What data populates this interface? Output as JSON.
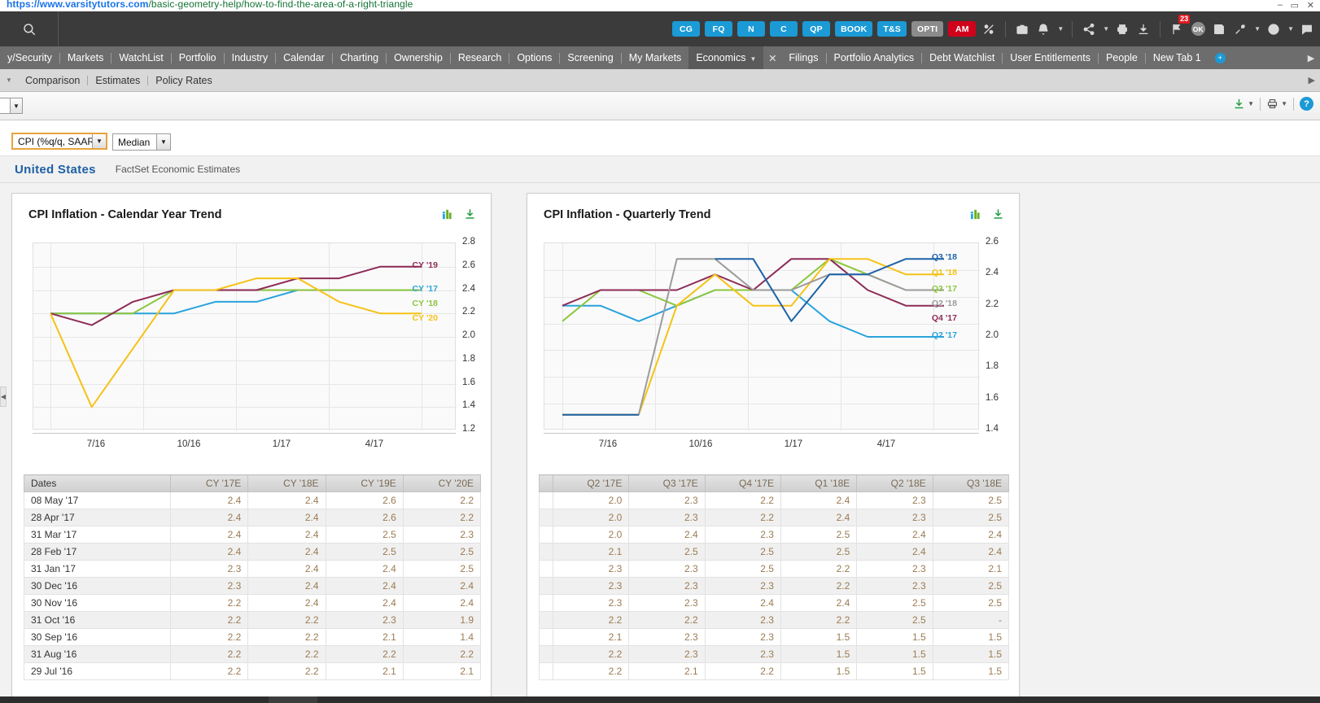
{
  "browser": {
    "url_protocol": "https://www.",
    "url_domain": "varsitytutors.com",
    "url_path": "/basic-geometry-help/how-to-find-the-area-of-a-right-triangle",
    "minimize": "–",
    "maximize": "▭",
    "close": "✕"
  },
  "header": {
    "search_icon": "search-icon",
    "quick_buttons": [
      {
        "label": "CG",
        "style": "blue"
      },
      {
        "label": "FQ",
        "style": "blue"
      },
      {
        "label": "N",
        "style": "blue"
      },
      {
        "label": "C",
        "style": "blue"
      },
      {
        "label": "QP",
        "style": "blue"
      },
      {
        "label": "BOOK",
        "style": "blue"
      },
      {
        "label": "T&S",
        "style": "blue"
      },
      {
        "label": "OPTI",
        "style": "gray"
      },
      {
        "label": "AM",
        "style": "red"
      }
    ],
    "notification_count": "23",
    "ok_label": "OK",
    "colors": {
      "blue": "#1b9ad6",
      "gray": "#8b8b8b",
      "red": "#d0021b"
    }
  },
  "nav": {
    "left_items": [
      "y/Security",
      "Markets",
      "WatchList",
      "Portfolio",
      "Industry",
      "Calendar",
      "Charting",
      "Ownership",
      "Research",
      "Options",
      "Screening",
      "My Markets"
    ],
    "active_tab": "Economics",
    "right_items": [
      "Filings",
      "Portfolio Analytics",
      "Debt Watchlist",
      "User Entitlements",
      "People",
      "New Tab 1"
    ],
    "add_tab": "+",
    "scroll_right": "▶"
  },
  "subnav": {
    "items": [
      "Comparison",
      "Estimates",
      "Policy Rates"
    ],
    "scroll_right": "▶"
  },
  "filters": {
    "metric": "CPI (%q/q, SAAR)",
    "statistic": "Median",
    "calendar_icon": "calendar-icon",
    "grid_icon": "grid-icon"
  },
  "country_row": {
    "country": "United States",
    "source": "FactSet Economic Estimates"
  },
  "chart_data": [
    {
      "id": "calendar-year",
      "type": "line",
      "title": "CPI Inflation - Calendar Year Trend",
      "xlabel": "",
      "ylabel": "",
      "ylim": [
        1.2,
        2.8
      ],
      "yticks": [
        "1.2",
        "1.4",
        "1.6",
        "1.8",
        "2.0",
        "2.2",
        "2.4",
        "2.6",
        "2.8"
      ],
      "xticks": [
        "7/16",
        "10/16",
        "1/17",
        "4/17"
      ],
      "grid": true,
      "legend_position": "right",
      "x": [
        "31 Aug '16",
        "30 Sep '16",
        "31 Oct '16",
        "30 Nov '16",
        "30 Dec '16",
        "31 Jan '17",
        "28 Feb '17",
        "31 Mar '17",
        "28 Apr '17",
        "08 May '17"
      ],
      "series": [
        {
          "name": "CY '17",
          "color": "#29a3dc",
          "values": [
            2.2,
            2.2,
            2.2,
            2.2,
            2.3,
            2.3,
            2.4,
            2.4,
            2.4,
            2.4
          ]
        },
        {
          "name": "CY '18",
          "color": "#8cc63e",
          "values": [
            2.2,
            2.2,
            2.2,
            2.4,
            2.4,
            2.4,
            2.4,
            2.4,
            2.4,
            2.4
          ]
        },
        {
          "name": "CY '19",
          "color": "#8e2b57",
          "values": [
            2.2,
            2.1,
            2.3,
            2.4,
            2.4,
            2.4,
            2.5,
            2.5,
            2.6,
            2.6
          ]
        },
        {
          "name": "CY '20",
          "color": "#f5c217",
          "values": [
            2.2,
            1.4,
            1.9,
            2.4,
            2.4,
            2.5,
            2.5,
            2.3,
            2.2,
            2.2
          ]
        }
      ]
    },
    {
      "id": "quarterly",
      "type": "line",
      "title": "CPI Inflation - Quarterly Trend",
      "xlabel": "",
      "ylabel": "",
      "ylim": [
        1.4,
        2.6
      ],
      "yticks": [
        "1.4",
        "1.6",
        "1.8",
        "2.0",
        "2.2",
        "2.4",
        "2.6"
      ],
      "xticks": [
        "7/16",
        "10/16",
        "1/17",
        "4/17"
      ],
      "grid": true,
      "legend_position": "right",
      "x": [
        "29 Jul '16",
        "31 Aug '16",
        "30 Sep '16",
        "31 Oct '16",
        "30 Nov '16",
        "30 Dec '16",
        "31 Jan '17",
        "28 Feb '17",
        "31 Mar '17",
        "28 Apr '17",
        "08 May '17"
      ],
      "series": [
        {
          "name": "Q2 '17",
          "color": "#29a3dc",
          "values": [
            2.2,
            2.2,
            2.1,
            2.2,
            2.3,
            2.3,
            2.3,
            2.1,
            2.0,
            2.0,
            2.0
          ]
        },
        {
          "name": "Q3 '17",
          "color": "#8cc63e",
          "values": [
            2.1,
            2.3,
            2.3,
            2.2,
            2.3,
            2.3,
            2.3,
            2.5,
            2.4,
            2.3,
            2.3
          ]
        },
        {
          "name": "Q4 '17",
          "color": "#8e2b57",
          "values": [
            2.2,
            2.3,
            2.3,
            2.3,
            2.4,
            2.3,
            2.5,
            2.5,
            2.3,
            2.2,
            2.2
          ]
        },
        {
          "name": "Q1 '18",
          "color": "#f5c217",
          "values": [
            1.5,
            1.5,
            1.5,
            2.2,
            2.4,
            2.2,
            2.2,
            2.5,
            2.5,
            2.4,
            2.4
          ]
        },
        {
          "name": "Q2 '18",
          "color": "#9b9b9b",
          "values": [
            1.5,
            1.5,
            1.5,
            2.5,
            2.5,
            2.3,
            2.3,
            2.4,
            2.4,
            2.3,
            2.3
          ]
        },
        {
          "name": "Q3 '18",
          "color": "#1e63a8",
          "values": [
            1.5,
            1.5,
            1.5,
            null,
            2.5,
            2.5,
            2.1,
            2.4,
            2.4,
            2.5,
            2.5
          ]
        }
      ]
    }
  ],
  "panels": {
    "left": {
      "title": "CPI Inflation - Calendar Year Trend",
      "icons": [
        "bar-chart-icon",
        "download-icon"
      ],
      "table": {
        "headers": [
          "Dates",
          "CY '17E",
          "CY '18E",
          "CY '19E",
          "CY '20E"
        ],
        "rows": [
          [
            "08 May '17",
            "2.4",
            "2.4",
            "2.6",
            "2.2"
          ],
          [
            "28 Apr '17",
            "2.4",
            "2.4",
            "2.6",
            "2.2"
          ],
          [
            "31 Mar '17",
            "2.4",
            "2.4",
            "2.5",
            "2.3"
          ],
          [
            "28 Feb '17",
            "2.4",
            "2.4",
            "2.5",
            "2.5"
          ],
          [
            "31 Jan '17",
            "2.3",
            "2.4",
            "2.4",
            "2.5"
          ],
          [
            "30 Dec '16",
            "2.3",
            "2.4",
            "2.4",
            "2.4"
          ],
          [
            "30 Nov '16",
            "2.2",
            "2.4",
            "2.4",
            "2.4"
          ],
          [
            "31 Oct '16",
            "2.2",
            "2.2",
            "2.3",
            "1.9"
          ],
          [
            "30 Sep '16",
            "2.2",
            "2.2",
            "2.1",
            "1.4"
          ],
          [
            "31 Aug '16",
            "2.2",
            "2.2",
            "2.2",
            "2.2"
          ],
          [
            "29 Jul '16",
            "2.2",
            "2.2",
            "2.1",
            "2.1"
          ]
        ]
      }
    },
    "right": {
      "title": "CPI Inflation - Quarterly Trend",
      "icons": [
        "bar-chart-icon",
        "download-icon"
      ],
      "table": {
        "headers": [
          "",
          "Q2 '17E",
          "Q3 '17E",
          "Q4 '17E",
          "Q1 '18E",
          "Q2 '18E",
          "Q3 '18E"
        ],
        "rows": [
          [
            "",
            "2.0",
            "2.3",
            "2.2",
            "2.4",
            "2.3",
            "2.5"
          ],
          [
            "",
            "2.0",
            "2.3",
            "2.2",
            "2.4",
            "2.3",
            "2.5"
          ],
          [
            "",
            "2.0",
            "2.4",
            "2.3",
            "2.5",
            "2.4",
            "2.4"
          ],
          [
            "",
            "2.1",
            "2.5",
            "2.5",
            "2.5",
            "2.4",
            "2.4"
          ],
          [
            "",
            "2.3",
            "2.3",
            "2.5",
            "2.2",
            "2.3",
            "2.1"
          ],
          [
            "",
            "2.3",
            "2.3",
            "2.3",
            "2.2",
            "2.3",
            "2.5"
          ],
          [
            "",
            "2.3",
            "2.3",
            "2.4",
            "2.4",
            "2.5",
            "2.5"
          ],
          [
            "",
            "2.2",
            "2.2",
            "2.3",
            "2.2",
            "2.5",
            "-"
          ],
          [
            "",
            "2.1",
            "2.3",
            "2.3",
            "1.5",
            "1.5",
            "1.5"
          ],
          [
            "",
            "2.2",
            "2.3",
            "2.3",
            "1.5",
            "1.5",
            "1.5"
          ],
          [
            "",
            "2.2",
            "2.1",
            "2.2",
            "1.5",
            "1.5",
            "1.5"
          ]
        ]
      }
    }
  }
}
